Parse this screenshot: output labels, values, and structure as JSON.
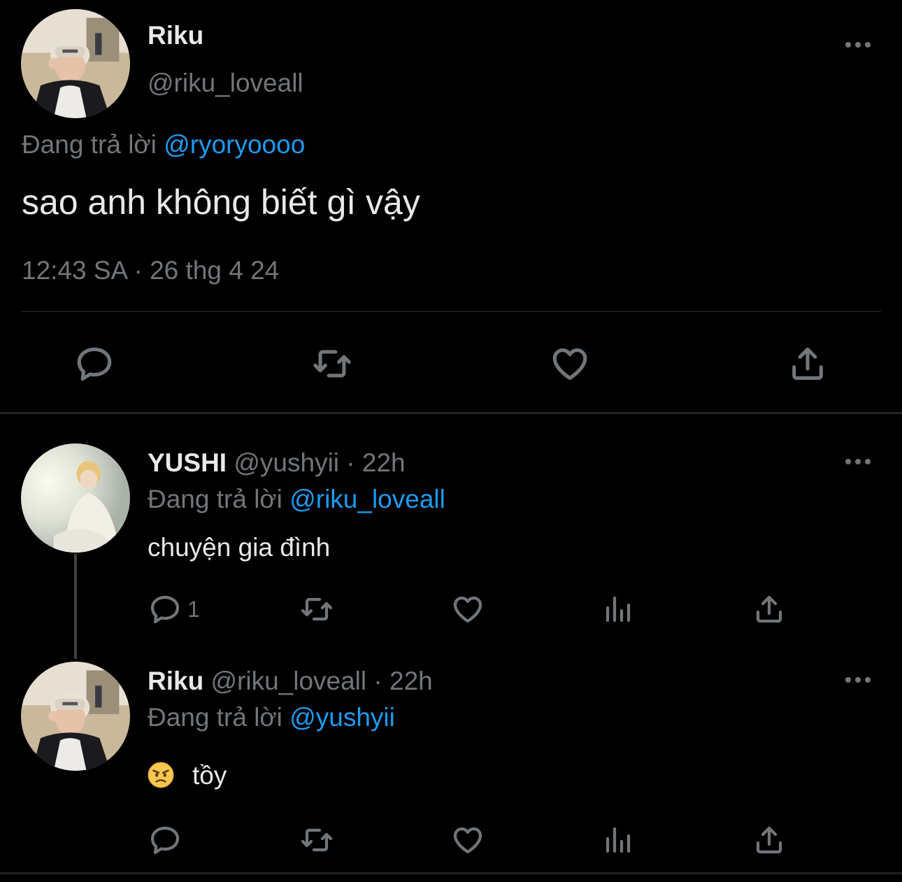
{
  "main_tweet": {
    "author_name": "Riku",
    "author_handle": "@riku_loveall",
    "replying_prefix": "Đang trả lời",
    "replying_to": "@ryoryoooo",
    "text": "sao anh không biết gì vậy",
    "time": "12:43 SA",
    "separator": "·",
    "date": "26 thg 4 24",
    "avatar_icon": "user-avatar-riku",
    "actions": [
      "reply-icon",
      "retweet-icon",
      "like-icon",
      "share-icon"
    ]
  },
  "replies": [
    {
      "author_name": "YUSHI",
      "author_handle": "@yushyii",
      "separator": "·",
      "age": "22h",
      "replying_prefix": "Đang trả lời",
      "replying_to": "@riku_loveall",
      "text": "chuyện gia đình",
      "emoji": "",
      "reply_count": "1",
      "avatar_icon": "user-avatar-yushi"
    },
    {
      "author_name": "Riku",
      "author_handle": "@riku_loveall",
      "separator": "·",
      "age": "22h",
      "replying_prefix": "Đang trả lời",
      "replying_to": "@yushyii",
      "text": "tồy",
      "emoji": "angry-face-emoji",
      "reply_count": "",
      "avatar_icon": "user-avatar-riku"
    }
  ],
  "colors": {
    "background": "#000000",
    "text": "#e7e9ea",
    "muted": "#71767b",
    "link": "#1d9bf0",
    "divider": "#2f3336"
  }
}
